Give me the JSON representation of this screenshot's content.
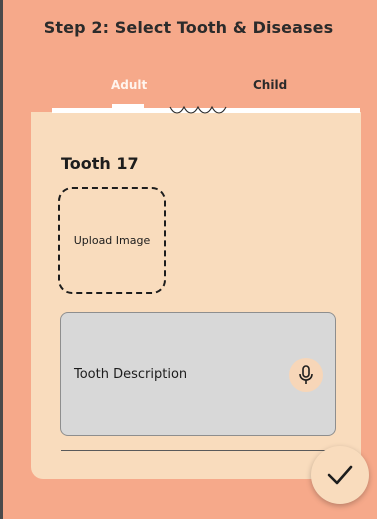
{
  "header": {
    "title": "Step 2: Select Tooth & Diseases"
  },
  "tabs": [
    {
      "label": "Adult",
      "active": true
    },
    {
      "label": "Child",
      "active": false
    }
  ],
  "tooth": {
    "title": "Tooth 17",
    "upload_label": "Upload Image",
    "description_label": "Tooth Description"
  },
  "icons": {
    "mic": "microphone-icon",
    "confirm": "checkmark-icon"
  },
  "colors": {
    "background": "#f6a98a",
    "card": "#f9dcbd",
    "description_box": "#d8d8d8"
  }
}
